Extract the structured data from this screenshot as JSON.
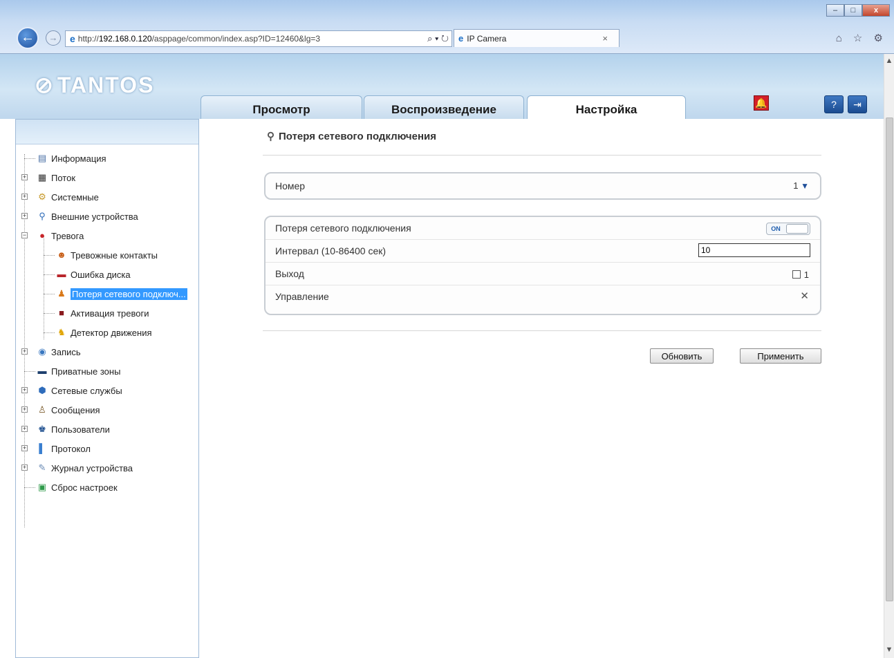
{
  "browser": {
    "url_prefix": "http://",
    "url_host": "192.168.0.120",
    "url_path": "/asppage/common/index.asp?ID=12460&lg=3",
    "tab_title": "IP Camera",
    "search_dropdown": "⌕ ▾ ↻",
    "tab_close": "×",
    "window_controls": {
      "minimize": "–",
      "maximize": "□",
      "close": "x"
    },
    "nav": {
      "back": "←",
      "forward": "→"
    },
    "toolbar_icons": "⌂ ☆ ⚙"
  },
  "header": {
    "logo": "TANTOS",
    "logo_mark": "⊘",
    "tabs": [
      {
        "label": "Просмотр"
      },
      {
        "label": "Воспроизведение"
      },
      {
        "label": "Настройка"
      }
    ],
    "alarm_icon": "🔔",
    "help_icon": "?",
    "logout_icon": "⇥"
  },
  "sidebar": {
    "items": [
      {
        "label": "Информация",
        "icon": "info-icon"
      },
      {
        "label": "Поток",
        "icon": "stream-icon"
      },
      {
        "label": "Системные",
        "icon": "system-icon"
      },
      {
        "label": "Внешние устройства",
        "icon": "usb-icon"
      },
      {
        "label": "Тревога",
        "icon": "alarm-icon"
      },
      {
        "label": "Тревожные контакты",
        "icon": "alarm-input-icon"
      },
      {
        "label": "Ошибка диска",
        "icon": "disk-error-icon"
      },
      {
        "label": "Потеря сетевого подключ...",
        "icon": "network-loss-icon"
      },
      {
        "label": "Активация тревоги",
        "icon": "alarm-activation-icon"
      },
      {
        "label": "Детектор движения",
        "icon": "motion-icon"
      },
      {
        "label": "Запись",
        "icon": "record-icon"
      },
      {
        "label": "Приватные зоны",
        "icon": "privacy-icon"
      },
      {
        "label": "Сетевые службы",
        "icon": "network-icon"
      },
      {
        "label": "Сообщения",
        "icon": "messages-icon"
      },
      {
        "label": "Пользователи",
        "icon": "users-icon"
      },
      {
        "label": "Протокол",
        "icon": "protocol-icon"
      },
      {
        "label": "Журнал устройства",
        "icon": "log-icon"
      },
      {
        "label": "Сброс настроек",
        "icon": "reset-icon"
      }
    ]
  },
  "main": {
    "title": "Потеря сетевого подключения",
    "number_label": "Номер",
    "number_value": "1",
    "rows": {
      "network_loss_label": "Потеря сетевого подключения",
      "network_loss_toggle": "ON",
      "interval_label": "Интервал (10-86400 сек)",
      "interval_value": "10",
      "output_label": "Выход",
      "output_channel": "1",
      "control_label": "Управление"
    },
    "refresh_button": "Обновить",
    "apply_button": "Применить"
  },
  "colors": {
    "accent": "#3399ff",
    "header_bg": "#c8dcf0",
    "alarm": "#d3202a"
  }
}
